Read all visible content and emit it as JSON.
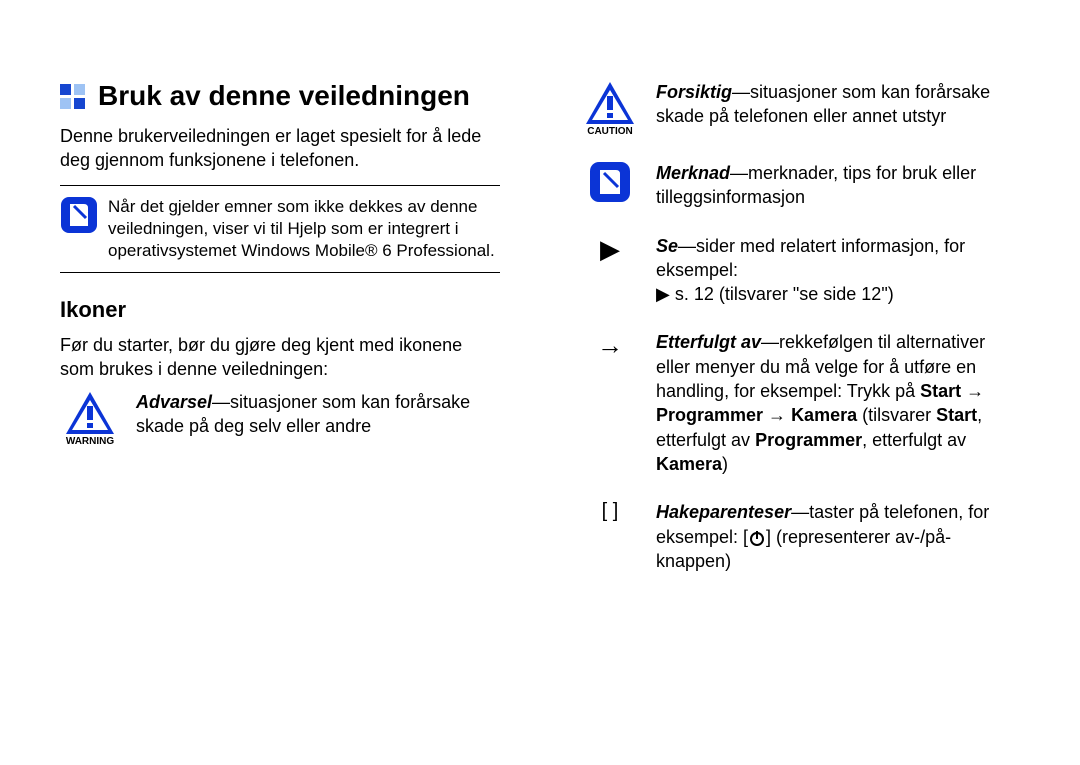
{
  "left": {
    "title": "Bruk av denne veiledningen",
    "intro": "Denne brukerveiledningen er laget spesielt for å lede deg gjennom funksjonene i telefonen.",
    "note": "Når det gjelder emner som ikke dekkes av denne veiledningen, viser vi til Hjelp som er integrert i operativsystemet Windows Mobile® 6 Professional.",
    "icons_heading": "Ikoner",
    "icons_intro": "Før du starter, bør du gjøre deg kjent med ikonene som brukes i denne veiledningen:",
    "warning_label": "Advarsel",
    "warning_text": "—situasjoner som kan forårsake skade på deg selv eller andre",
    "warning_caption": "WARNING"
  },
  "right": {
    "caution_label": "Forsiktig",
    "caution_text": "—situasjoner som kan forårsake skade på telefonen eller annet utstyr",
    "caution_caption": "CAUTION",
    "merknad_label": "Merknad",
    "merknad_text": "—merknader, tips for bruk eller tilleggsinformasjon",
    "se_label": "Se",
    "se_text1": "—sider med relatert informasjon, for eksempel:",
    "se_text2": " s. 12 (tilsvarer \"se side 12\")",
    "etter_label": "Etterfulgt av",
    "etter_text1": "—rekkefølgen til alternativer eller menyer du må velge for å utføre en handling, for eksempel: Trykk på ",
    "etter_start": "Start",
    "etter_arrow": " → ",
    "etter_prog": "Programmer",
    "etter_kam": "Kamera",
    "etter_text2": " (tilsvarer ",
    "etter_text3": ", etterfulgt av ",
    "etter_text4": ", etterfulgt av ",
    "etter_text5": ")",
    "hake_label": "Hakeparenteser",
    "hake_text1": "—taster på telefonen, for eksempel: [",
    "hake_text2": "] (representerer av-/på-knappen)",
    "hake_sym": "[   ]",
    "tri_sym": "▶",
    "arrow_sym": "→"
  }
}
